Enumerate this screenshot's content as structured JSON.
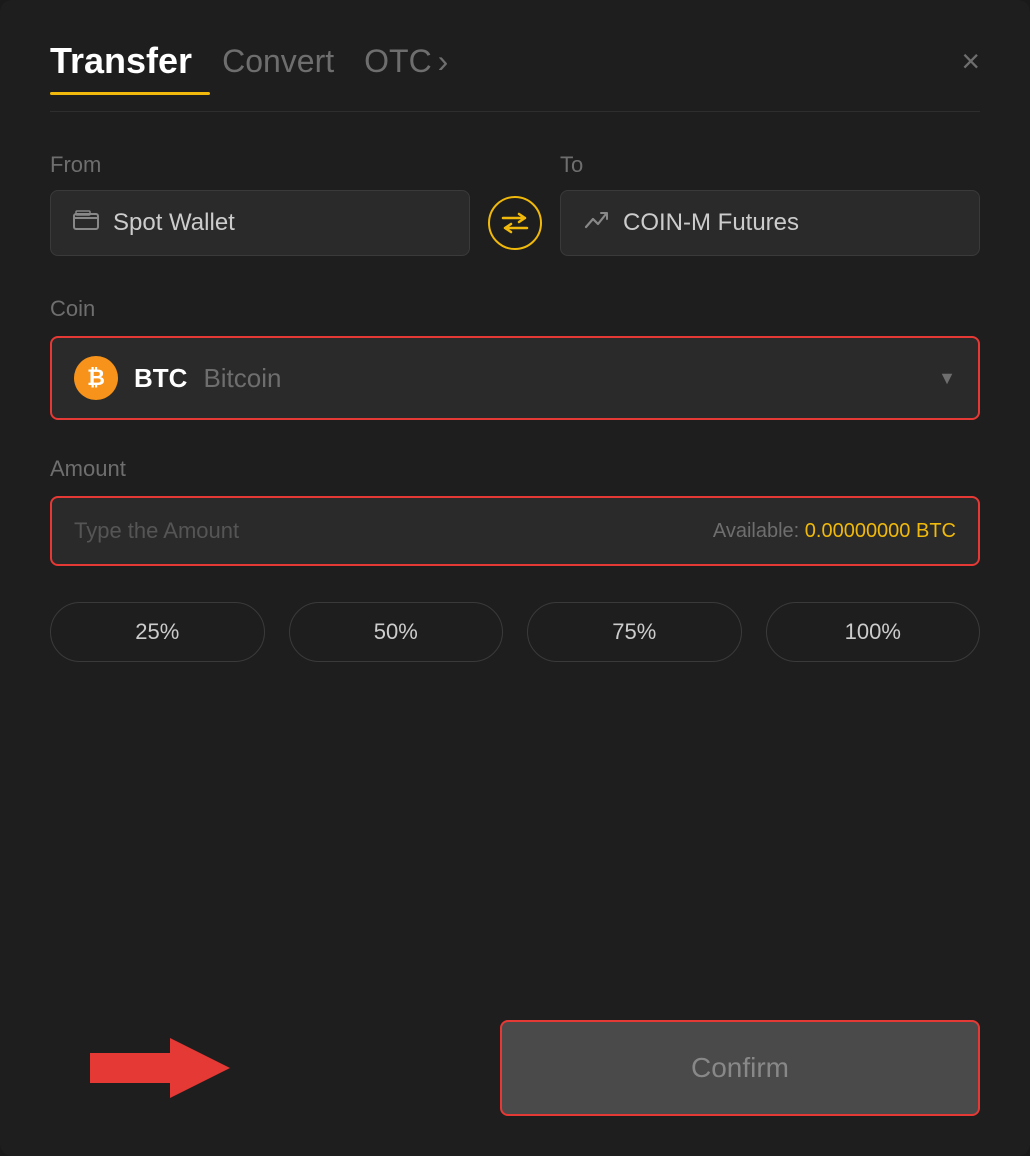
{
  "header": {
    "tab_transfer": "Transfer",
    "tab_convert": "Convert",
    "tab_otc": "OTC",
    "close_label": "×"
  },
  "from_section": {
    "label": "From",
    "wallet_label": "Spot Wallet"
  },
  "to_section": {
    "label": "To",
    "wallet_label": "COIN-M Futures"
  },
  "coin_section": {
    "label": "Coin",
    "coin_symbol": "BTC",
    "coin_name": "Bitcoin"
  },
  "amount_section": {
    "label": "Amount",
    "placeholder": "Type the Amount",
    "available_label": "Available:",
    "available_value": "0.00000000 BTC"
  },
  "pct_buttons": [
    "25%",
    "50%",
    "75%",
    "100%"
  ],
  "confirm_button": {
    "label": "Confirm"
  }
}
